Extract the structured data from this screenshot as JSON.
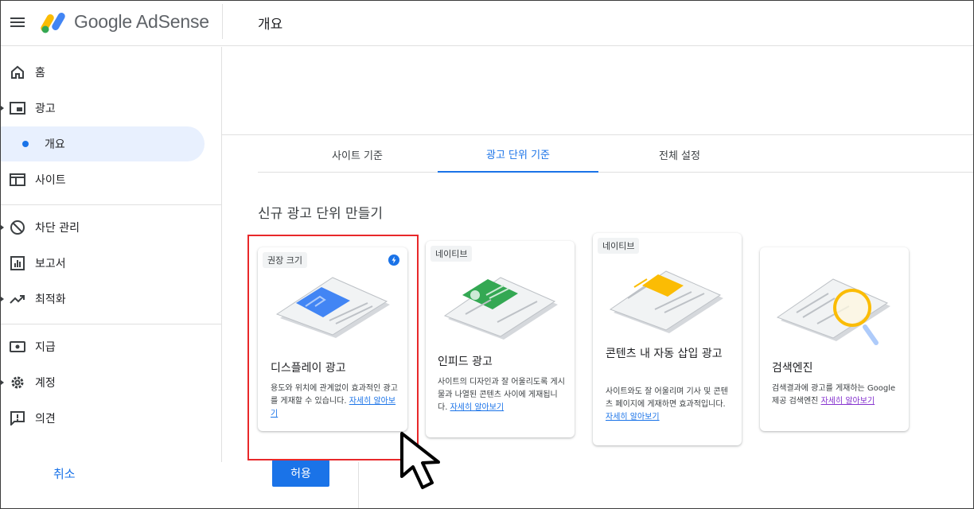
{
  "header": {
    "brand": "Google AdSense",
    "page_title": "개요"
  },
  "sidebar": {
    "items": [
      {
        "label": "홈",
        "icon": "home-icon"
      },
      {
        "label": "광고",
        "icon": "ads-icon"
      },
      {
        "label": "개요",
        "icon": "dot-icon",
        "active": true
      },
      {
        "label": "사이트",
        "icon": "sites-icon"
      },
      {
        "label": "차단 관리",
        "icon": "block-icon"
      },
      {
        "label": "보고서",
        "icon": "reports-icon"
      },
      {
        "label": "최적화",
        "icon": "trending-icon"
      },
      {
        "label": "지급",
        "icon": "payments-icon"
      },
      {
        "label": "계정",
        "icon": "gear-icon"
      },
      {
        "label": "의견",
        "icon": "feedback-icon"
      }
    ]
  },
  "tabs": [
    {
      "label": "사이트 기준"
    },
    {
      "label": "광고 단위 기준",
      "active": true
    },
    {
      "label": "전체 설정"
    }
  ],
  "section_title": "신규 광고 단위 만들기",
  "cards": [
    {
      "chip": "권장 크기",
      "title": "디스플레이 광고",
      "desc": "용도와 위치에 관계없이 효과적인 광고를 게재할 수 있습니다.",
      "link": "자세히 알아보기"
    },
    {
      "chip": "네이티브",
      "title": "인피드 광고",
      "desc": "사이트의 디자인과 잘 어울리도록 게시물과 나열된 콘텐츠 사이에 게재됩니다.",
      "link": "자세히 알아보기"
    },
    {
      "chip": "네이티브",
      "title": "콘텐츠 내 자동 삽입 광고",
      "desc": "사이트와도 잘 어울리며 기사 및 콘텐츠 페이지에 게재하면 효과적입니다.",
      "link": "자세히 알아보기"
    },
    {
      "chip": "",
      "title": "검색엔진",
      "desc": "검색결과에 광고를 게재하는 Google 제공 검색엔진",
      "link": "자세히 알아보기"
    }
  ],
  "footer": {
    "cancel_label": "취소",
    "allow_label": "허용"
  },
  "colors": {
    "accent": "#1a73e8",
    "highlight_box": "#e8282a",
    "active_nav_bg": "#e8f0fe"
  }
}
